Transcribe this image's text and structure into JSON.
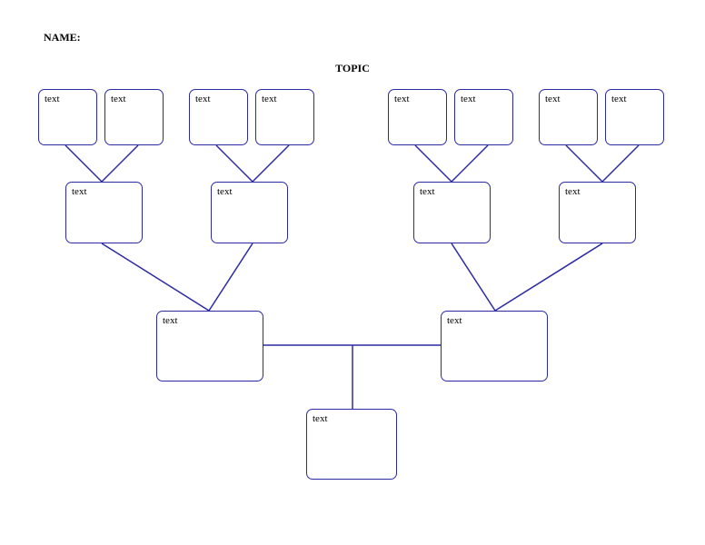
{
  "header": {
    "name_label": "NAME:",
    "topic_label": "TOPIC"
  },
  "row1": {
    "b0": "text",
    "b1": "text",
    "b2": "text",
    "b3": "text",
    "b4": "text",
    "b5": "text",
    "b6": "text",
    "b7": "text"
  },
  "row2": {
    "b0": "text",
    "b1": "text",
    "b2": "text",
    "b3": "text"
  },
  "row3": {
    "b0": "text",
    "b1": "text"
  },
  "row4": {
    "b0": "text"
  }
}
